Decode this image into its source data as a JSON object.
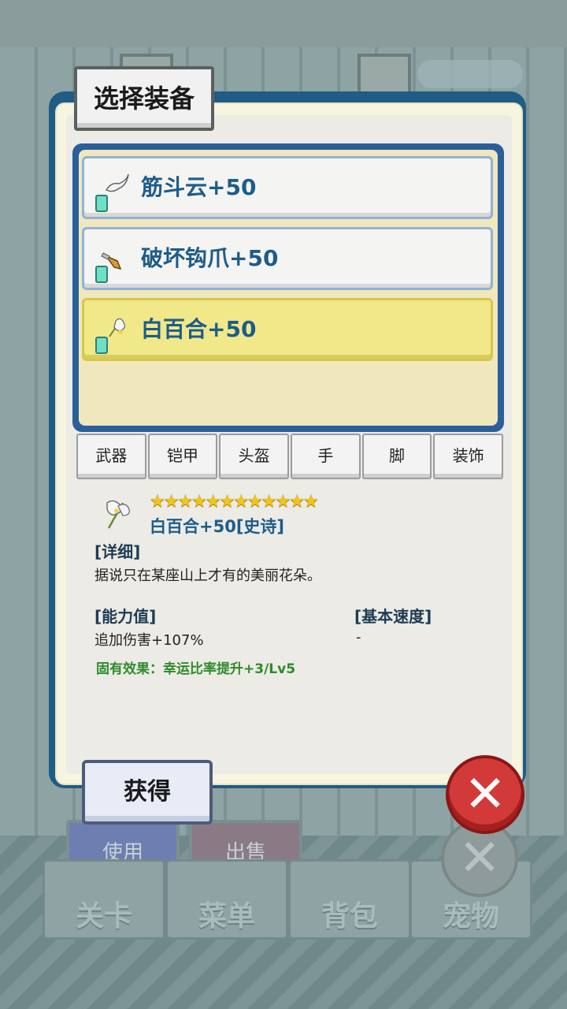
{
  "title": "选择装备",
  "items": [
    {
      "name": "筋斗云+50",
      "icon": "cloud-icon",
      "selected": false
    },
    {
      "name": "破坏钩爪+50",
      "icon": "claw-icon",
      "selected": false
    },
    {
      "name": "白百合+50",
      "icon": "lily-icon",
      "selected": true
    }
  ],
  "tabs": [
    "武器",
    "铠甲",
    "头盔",
    "手",
    "脚",
    "装饰"
  ],
  "detail": {
    "stars": "★★★★★★★★★★★★",
    "name": "白百合+50[史诗]",
    "desc_label": "[详细]",
    "desc": "据说只在某座山上才有的美丽花朵。",
    "ability_label": "[能力值]",
    "ability_value": "追加伤害+107%",
    "speed_label": "[基本速度]",
    "speed_value": "-",
    "effect": "固有效果：幸运比率提升+3/Lv5"
  },
  "obtain_label": "获得",
  "background": {
    "use_label": "使用",
    "sell_label": "出售",
    "nav": [
      "关卡",
      "菜单",
      "背包",
      "宠物"
    ]
  },
  "colors": {
    "accent": "#1d5c8a",
    "selected": "#f1e88a",
    "close": "#d23a3a",
    "effect": "#2e8a2a"
  }
}
